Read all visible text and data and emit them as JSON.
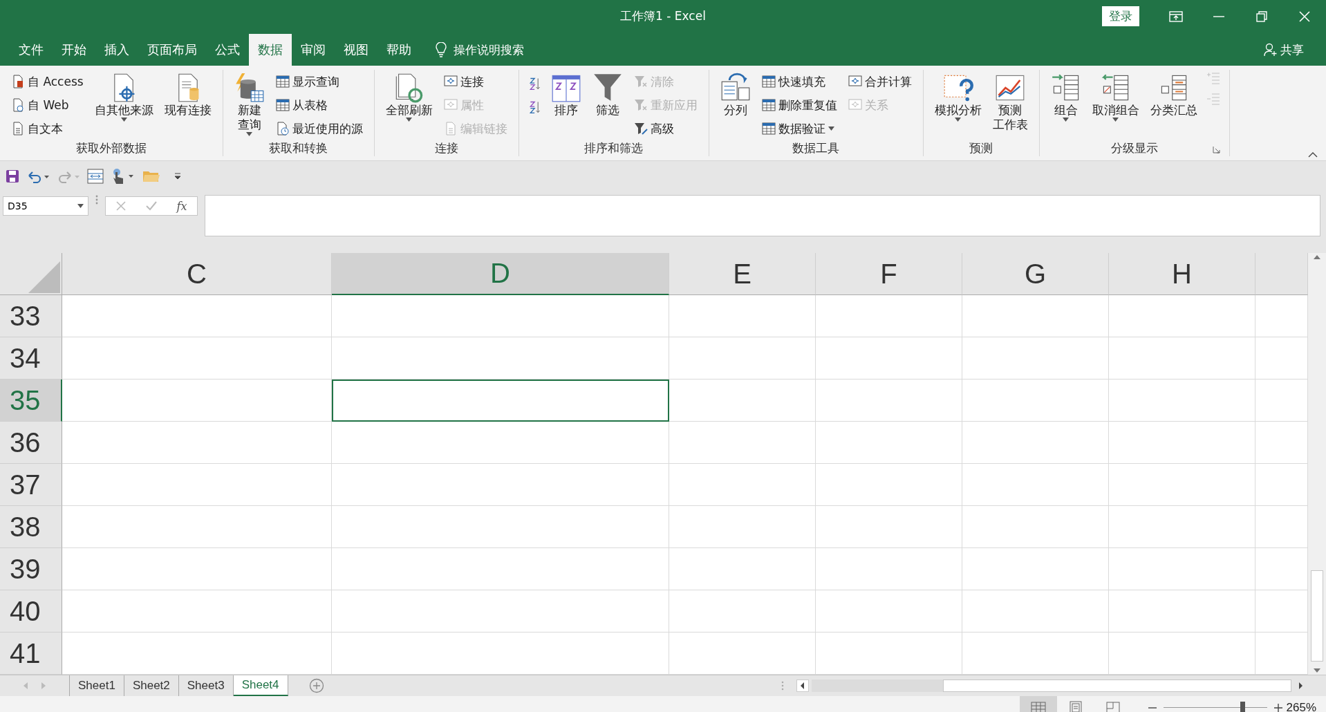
{
  "window": {
    "title": "工作簿1  -  Excel",
    "login": "登录"
  },
  "tabs": [
    {
      "label": "文件",
      "selected": false
    },
    {
      "label": "开始",
      "selected": false
    },
    {
      "label": "插入",
      "selected": false
    },
    {
      "label": "页面布局",
      "selected": false
    },
    {
      "label": "公式",
      "selected": false
    },
    {
      "label": "数据",
      "selected": true
    },
    {
      "label": "审阅",
      "selected": false
    },
    {
      "label": "视图",
      "selected": false
    },
    {
      "label": "帮助",
      "selected": false
    }
  ],
  "search": {
    "placeholder": "操作说明搜索"
  },
  "share": "共享",
  "ribbon": [
    {
      "label": "获取外部数据",
      "items": [
        {
          "kind": "stack",
          "items": [
            {
              "label": "自 Access",
              "disabled": false
            },
            {
              "label": "自 Web",
              "disabled": false
            },
            {
              "label": "自文本",
              "disabled": false
            }
          ]
        },
        {
          "kind": "large",
          "label": "自其他来源",
          "dropdown": true,
          "disabled": false
        },
        {
          "kind": "large",
          "label": "现有连接",
          "dropdown": false,
          "disabled": false
        }
      ]
    },
    {
      "label": "获取和转换",
      "items": [
        {
          "kind": "large",
          "lines": [
            "新建",
            "查询"
          ],
          "dropdown": true,
          "disabled": false
        },
        {
          "kind": "stack",
          "items": [
            {
              "label": "显示查询",
              "disabled": false
            },
            {
              "label": "从表格",
              "disabled": false
            },
            {
              "label": "最近使用的源",
              "disabled": false
            }
          ]
        }
      ]
    },
    {
      "label": "连接",
      "items": [
        {
          "kind": "large",
          "label": "全部刷新",
          "dropdown": true,
          "disabled": false
        },
        {
          "kind": "stack",
          "items": [
            {
              "label": "连接",
              "disabled": false
            },
            {
              "label": "属性",
              "disabled": true
            },
            {
              "label": "编辑链接",
              "disabled": true
            }
          ]
        }
      ]
    },
    {
      "label": "排序和筛选",
      "items": [
        {
          "kind": "sorticons"
        },
        {
          "kind": "large",
          "label": "排序",
          "dropdown": false,
          "disabled": false
        },
        {
          "kind": "large",
          "label": "筛选",
          "dropdown": false,
          "disabled": false
        },
        {
          "kind": "stack",
          "items": [
            {
              "label": "清除",
              "disabled": true
            },
            {
              "label": "重新应用",
              "disabled": true
            },
            {
              "label": "高级",
              "disabled": false
            }
          ]
        }
      ]
    },
    {
      "label": "数据工具",
      "items": [
        {
          "kind": "large",
          "label": "分列",
          "dropdown": false,
          "disabled": false
        },
        {
          "kind": "stack",
          "items": [
            {
              "label": "快速填充",
              "disabled": false
            },
            {
              "label": "删除重复值",
              "disabled": false
            },
            {
              "label": "数据验证",
              "disabled": false,
              "dropdown": true
            }
          ]
        },
        {
          "kind": "stack",
          "items": [
            {
              "label": "合并计算",
              "disabled": false
            },
            {
              "label": "关系",
              "disabled": true
            }
          ]
        }
      ]
    },
    {
      "label": "预测",
      "items": [
        {
          "kind": "large",
          "label": "模拟分析",
          "dropdown": true,
          "disabled": false
        },
        {
          "kind": "large",
          "lines": [
            "预测",
            "工作表"
          ],
          "dropdown": false,
          "disabled": false
        }
      ]
    },
    {
      "label": "分级显示",
      "items": [
        {
          "kind": "large",
          "label": "组合",
          "dropdown": true,
          "disabled": false
        },
        {
          "kind": "large",
          "label": "取消组合",
          "dropdown": true,
          "disabled": false
        },
        {
          "kind": "large",
          "label": "分类汇总",
          "dropdown": false,
          "disabled": false
        },
        {
          "kind": "detailicons"
        }
      ]
    }
  ],
  "name_box": "D35",
  "fx": "fx",
  "columns": [
    {
      "label": "C",
      "selected": false
    },
    {
      "label": "D",
      "selected": true
    },
    {
      "label": "E",
      "selected": false
    },
    {
      "label": "F",
      "selected": false
    },
    {
      "label": "G",
      "selected": false
    },
    {
      "label": "H",
      "selected": false
    }
  ],
  "rows": [
    {
      "label": "33",
      "selected": false
    },
    {
      "label": "34",
      "selected": false
    },
    {
      "label": "35",
      "selected": true
    },
    {
      "label": "36",
      "selected": false
    },
    {
      "label": "37",
      "selected": false
    },
    {
      "label": "38",
      "selected": false
    },
    {
      "label": "39",
      "selected": false
    },
    {
      "label": "40",
      "selected": false
    },
    {
      "label": "41",
      "selected": false
    }
  ],
  "sheets": [
    {
      "label": "Sheet1",
      "selected": false
    },
    {
      "label": "Sheet2",
      "selected": false
    },
    {
      "label": "Sheet3",
      "selected": false
    },
    {
      "label": "Sheet4",
      "selected": true
    }
  ],
  "views": [
    {
      "kind": "normal",
      "selected": true
    },
    {
      "kind": "page",
      "selected": false
    },
    {
      "kind": "break",
      "selected": false
    }
  ],
  "zoom": {
    "level": 0.76,
    "reading": "265%"
  }
}
